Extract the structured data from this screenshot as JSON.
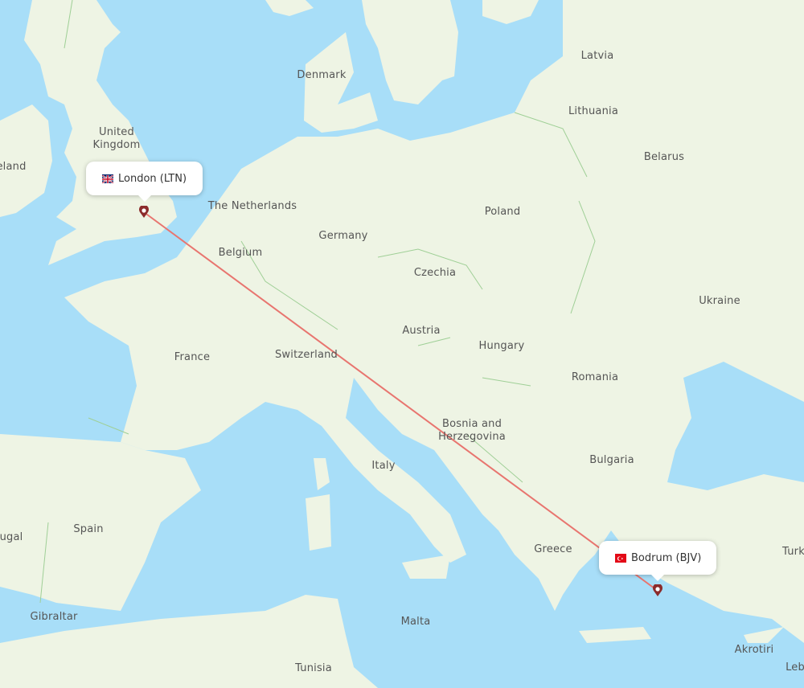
{
  "map": {
    "colors": {
      "water": "#a8def8",
      "land": "#eef4e4",
      "border": "#9fcf96",
      "route": "#e8756f",
      "marker": "#8b2b2b"
    },
    "origin": {
      "city": "London",
      "code": "LTN",
      "label": "London (LTN)",
      "flag": "gb-flag"
    },
    "destination": {
      "city": "Bodrum",
      "code": "BJV",
      "label": "Bodrum (BJV)",
      "flag": "tr-flag"
    },
    "labels": [
      {
        "id": "latvia",
        "text": "Latvia"
      },
      {
        "id": "denmark",
        "text": "Denmark"
      },
      {
        "id": "lithuania",
        "text": "Lithuania"
      },
      {
        "id": "united-kingdom",
        "text": "United Kingdom"
      },
      {
        "id": "ireland",
        "text": "eland"
      },
      {
        "id": "belarus",
        "text": "Belarus"
      },
      {
        "id": "the-netherlands",
        "text": "The Netherlands"
      },
      {
        "id": "poland",
        "text": "Poland"
      },
      {
        "id": "germany",
        "text": "Germany"
      },
      {
        "id": "belgium",
        "text": "Belgium"
      },
      {
        "id": "czechia",
        "text": "Czechia"
      },
      {
        "id": "ukraine",
        "text": "Ukraine"
      },
      {
        "id": "austria",
        "text": "Austria"
      },
      {
        "id": "france",
        "text": "France"
      },
      {
        "id": "switzerland",
        "text": "Switzerland"
      },
      {
        "id": "hungary",
        "text": "Hungary"
      },
      {
        "id": "romania",
        "text": "Romania"
      },
      {
        "id": "bosnia",
        "text": "Bosnia and Herzegovina"
      },
      {
        "id": "italy",
        "text": "Italy"
      },
      {
        "id": "bulgaria",
        "text": "Bulgaria"
      },
      {
        "id": "spain",
        "text": "Spain"
      },
      {
        "id": "portugal",
        "text": "ugal"
      },
      {
        "id": "greece",
        "text": "Greece"
      },
      {
        "id": "turkey",
        "text": "Turk"
      },
      {
        "id": "gibraltar",
        "text": "Gibraltar"
      },
      {
        "id": "malta",
        "text": "Malta"
      },
      {
        "id": "akrotiri",
        "text": "Akrotiri"
      },
      {
        "id": "tunisia",
        "text": "Tunisia"
      },
      {
        "id": "lebanon",
        "text": "Leb"
      }
    ]
  }
}
